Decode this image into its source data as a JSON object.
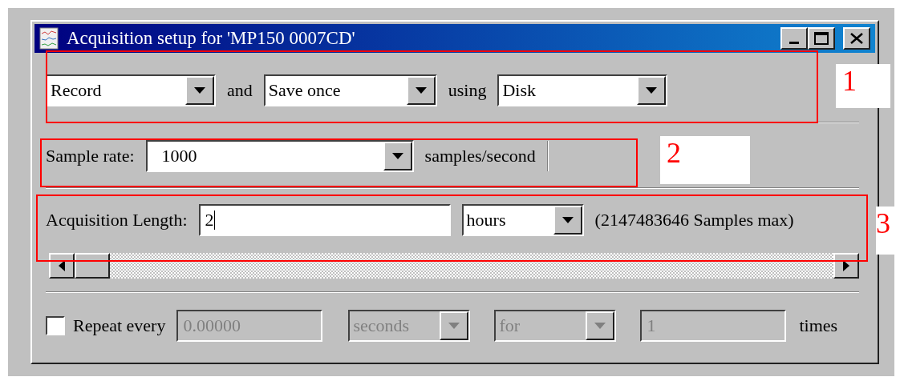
{
  "window": {
    "title": "Acquisition setup for 'MP150 0007CD'"
  },
  "mode_row": {
    "mode": {
      "value": "Record"
    },
    "and_label": "and",
    "save": {
      "value": "Save once"
    },
    "using_label": "using",
    "target": {
      "value": "Disk"
    }
  },
  "sample_rate": {
    "label": "Sample rate:",
    "value": "1000",
    "unit": "samples/second"
  },
  "acquisition_length": {
    "label": "Acquisition Length:",
    "value": "2",
    "unit": {
      "value": "hours"
    },
    "max_note": "(2147483646 Samples max)"
  },
  "repeat": {
    "checked": false,
    "label": "Repeat every",
    "interval": {
      "value": "0.00000",
      "disabled": true
    },
    "interval_unit": {
      "value": "seconds",
      "disabled": true
    },
    "mode": {
      "value": "for",
      "disabled": true
    },
    "count": {
      "value": "1",
      "disabled": true
    },
    "times_label": "times"
  },
  "annotations": [
    {
      "label": "1"
    },
    {
      "label": "2"
    },
    {
      "label": "3"
    }
  ]
}
